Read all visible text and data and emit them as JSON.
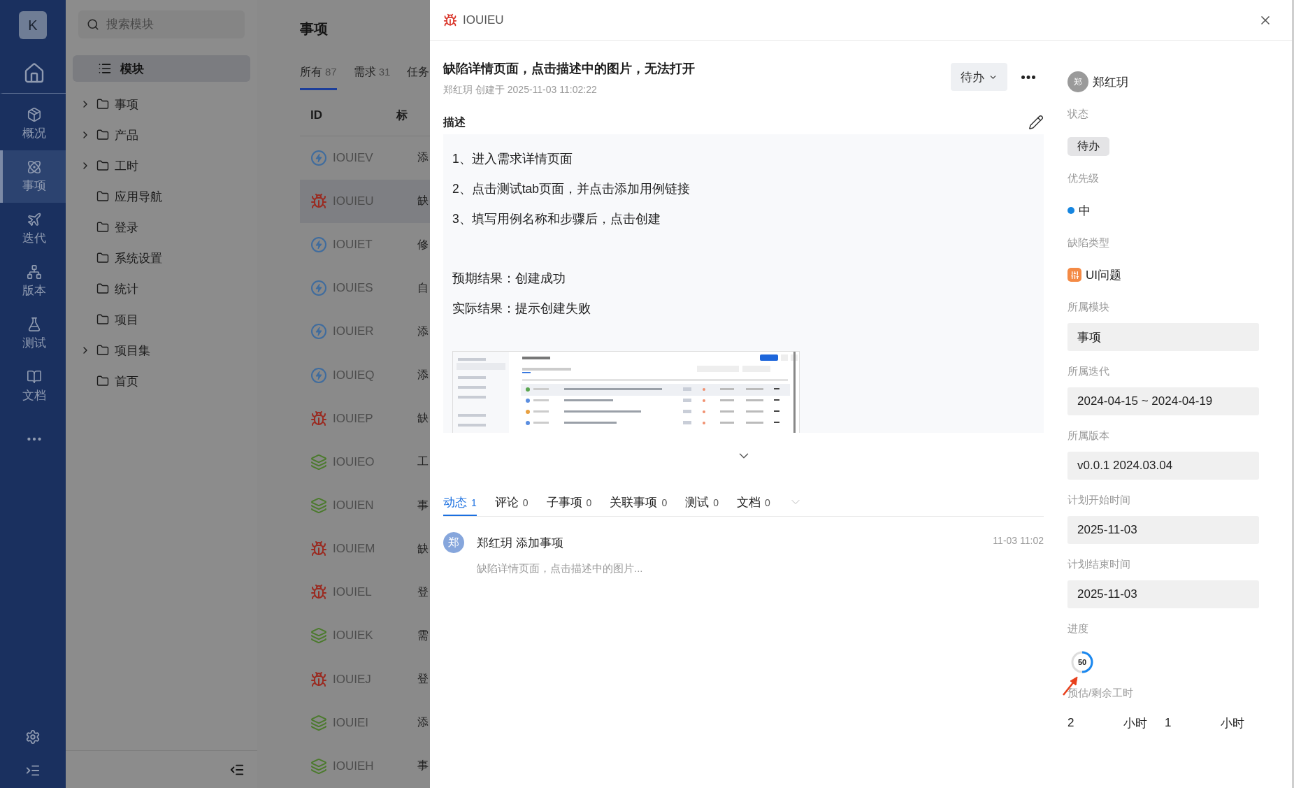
{
  "nav": {
    "logo": "K",
    "items": [
      {
        "kind": "home",
        "selected": false
      },
      {
        "kind": "overview",
        "label": "概况",
        "selected": false
      },
      {
        "kind": "items",
        "label": "事项",
        "selected": true
      },
      {
        "kind": "iteration",
        "label": "迭代",
        "selected": false
      },
      {
        "kind": "version",
        "label": "版本",
        "selected": false
      },
      {
        "kind": "test",
        "label": "测试",
        "selected": false
      },
      {
        "kind": "docs",
        "label": "文档",
        "selected": false
      }
    ]
  },
  "sidebar": {
    "search": {
      "placeholder": "搜索模块"
    },
    "header": "模块",
    "tree": [
      {
        "label": "事项",
        "expandable": true
      },
      {
        "label": "产品",
        "expandable": true
      },
      {
        "label": "工时",
        "expandable": true
      },
      {
        "label": "应用导航",
        "expandable": false
      },
      {
        "label": "登录",
        "expandable": false
      },
      {
        "label": "系统设置",
        "expandable": false
      },
      {
        "label": "统计",
        "expandable": false
      },
      {
        "label": "项目",
        "expandable": false
      },
      {
        "label": "项目集",
        "expandable": true
      },
      {
        "label": "首页",
        "expandable": false
      }
    ]
  },
  "list": {
    "title": "事项",
    "tabs": [
      {
        "label": "所有",
        "count": "87",
        "selected": true
      },
      {
        "label": "需求",
        "count": "31",
        "selected": false
      },
      {
        "label": "任务",
        "selected": false
      }
    ],
    "columns": [
      "ID",
      "标"
    ],
    "rows": [
      {
        "kind": "task",
        "id": "IOUIEV",
        "title": "添",
        "selected": false
      },
      {
        "kind": "defect",
        "id": "IOUIEU",
        "title": "缺",
        "selected": true
      },
      {
        "kind": "task",
        "id": "IOUIET",
        "title": "修",
        "selected": false
      },
      {
        "kind": "task",
        "id": "IOUIES",
        "title": "自",
        "selected": false
      },
      {
        "kind": "task",
        "id": "IOUIER",
        "title": "添",
        "selected": false
      },
      {
        "kind": "task",
        "id": "IOUIEQ",
        "title": "添",
        "selected": false
      },
      {
        "kind": "defect",
        "id": "IOUIEP",
        "title": "缺",
        "selected": false
      },
      {
        "kind": "story",
        "id": "IOUIEO",
        "title": "工",
        "selected": false
      },
      {
        "kind": "story",
        "id": "IOUIEN",
        "title": "事",
        "selected": false
      },
      {
        "kind": "defect",
        "id": "IOUIEM",
        "title": "缺",
        "selected": false
      },
      {
        "kind": "defect",
        "id": "IOUIEL",
        "title": "登",
        "selected": false
      },
      {
        "kind": "story",
        "id": "IOUIEK",
        "title": "需",
        "selected": false
      },
      {
        "kind": "defect",
        "id": "IOUIEJ",
        "title": "登",
        "selected": false
      },
      {
        "kind": "story",
        "id": "IOUIEI",
        "title": "添",
        "selected": false
      },
      {
        "kind": "story",
        "id": "IOUIEH",
        "title": "事",
        "selected": false
      }
    ]
  },
  "drawer": {
    "kind": "defect",
    "id": "IOUIEU",
    "title": "缺陷详情页面，点击描述中的图片，无法打开",
    "meta": "郑红玥 创建于 2025-11-03 11:02:22",
    "status": "待办",
    "description": {
      "heading": "描述",
      "steps": [
        "1、进入需求详情页面",
        "2、点击测试tab页面，并点击添加用例链接",
        "3、填写用例名称和步骤后，点击创建"
      ],
      "results": [
        "预期结果：创建成功",
        "实际结果：提示创建失败"
      ],
      "attachment": {
        "kind": "screenshot"
      }
    },
    "tabs": [
      {
        "label": "动态",
        "count": "1",
        "selected": true
      },
      {
        "label": "评论",
        "count": "0",
        "selected": false
      },
      {
        "label": "子事项",
        "count": "0",
        "selected": false
      },
      {
        "label": "关联事项",
        "count": "0",
        "selected": false
      },
      {
        "label": "测试",
        "count": "0",
        "selected": false
      },
      {
        "label": "文档",
        "count": "0",
        "selected": false
      }
    ],
    "activity": [
      {
        "avatar": "郑",
        "title": "郑红玥 添加事项",
        "time": "11-03 11:02",
        "summary": "缺陷详情页面，点击描述中的图片..."
      }
    ],
    "properties": [
      {
        "kind": "user",
        "avatar": "郑",
        "value": "郑红玥"
      },
      {
        "kind": "tag",
        "label": "状态",
        "value": "待办"
      },
      {
        "kind": "priority",
        "label": "优先级",
        "value": "中",
        "color": "#1585e0"
      },
      {
        "kind": "type",
        "label": "缺陷类型",
        "value": "UI问题"
      },
      {
        "kind": "select",
        "label": "所属模块",
        "value": "事项"
      },
      {
        "kind": "select",
        "label": "所属迭代",
        "value": "2024-04-15 ~ 2024-04-19"
      },
      {
        "kind": "select",
        "label": "所属版本",
        "value": "v0.0.1 2024.03.04"
      },
      {
        "kind": "select",
        "label": "计划开始时间",
        "value": "2025-11-03"
      },
      {
        "kind": "select",
        "label": "计划结束时间",
        "value": "2025-11-03"
      },
      {
        "kind": "progress",
        "label": "进度",
        "value": "50",
        "level": 0.5,
        "annotated": true
      },
      {
        "kind": "hours",
        "label": "预估/剩余工时",
        "fields": [
          {
            "value": "2",
            "unit": "小时"
          },
          {
            "value": "1",
            "unit": "小时"
          }
        ]
      }
    ]
  }
}
